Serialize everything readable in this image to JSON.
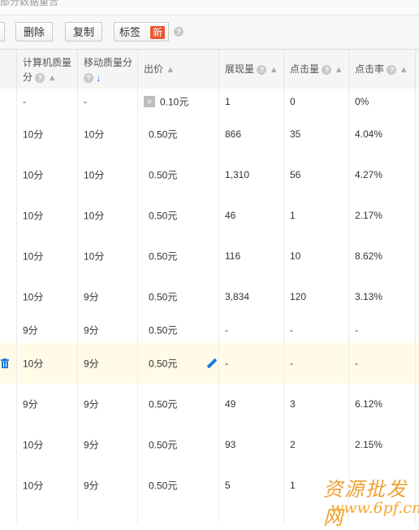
{
  "top_strip": {
    "text": "部分数据重合"
  },
  "toolbar": {
    "delete_label": "删除",
    "copy_label": "复制",
    "tag_label": "标签",
    "new_badge": "新",
    "help_glyph": "?"
  },
  "columns": {
    "pc_quality": [
      "计算机质量",
      "分"
    ],
    "mobile_quality": "移动质量分",
    "bid": "出价",
    "impressions": "展现量",
    "clicks": "点击量",
    "ctr": "点击率"
  },
  "icons": {
    "sort_asc": "sort-up-arrow-icon",
    "sort_desc_active": "sort-down-arrow-icon",
    "bid_tag": "bid-strategy-icon",
    "edit": "pencil-icon",
    "delete_row": "trash-icon"
  },
  "accent_color": "#1d7ad9",
  "badge_color": "#e9542f",
  "rows": [
    {
      "pc": "-",
      "mobile": "-",
      "bid": "0.10元",
      "impr": "1",
      "clicks": "0",
      "ctr": "0%",
      "has_bid_icon": true
    },
    {
      "pc": "10分",
      "mobile": "10分",
      "bid": "0.50元",
      "impr": "866",
      "clicks": "35",
      "ctr": "4.04%"
    },
    {
      "pc": "10分",
      "mobile": "10分",
      "bid": "0.50元",
      "impr": "1,310",
      "clicks": "56",
      "ctr": "4.27%"
    },
    {
      "pc": "10分",
      "mobile": "10分",
      "bid": "0.50元",
      "impr": "46",
      "clicks": "1",
      "ctr": "2.17%"
    },
    {
      "pc": "10分",
      "mobile": "10分",
      "bid": "0.50元",
      "impr": "116",
      "clicks": "10",
      "ctr": "8.62%"
    },
    {
      "pc": "10分",
      "mobile": "9分",
      "bid": "0.50元",
      "impr": "3,834",
      "clicks": "120",
      "ctr": "3.13%"
    },
    {
      "pc": "9分",
      "mobile": "9分",
      "bid": "0.50元",
      "impr": "-",
      "clicks": "-",
      "ctr": "-"
    },
    {
      "pc": "10分",
      "mobile": "9分",
      "bid": "0.50元",
      "impr": "-",
      "clicks": "-",
      "ctr": "-",
      "highlighted": true
    },
    {
      "pc": "9分",
      "mobile": "9分",
      "bid": "0.50元",
      "impr": "49",
      "clicks": "3",
      "ctr": "6.12%"
    },
    {
      "pc": "10分",
      "mobile": "9分",
      "bid": "0.50元",
      "impr": "93",
      "clicks": "2",
      "ctr": "2.15%"
    },
    {
      "pc": "10分",
      "mobile": "9分",
      "bid": "0.50元",
      "impr": "5",
      "clicks": "1",
      "ctr": ""
    }
  ],
  "watermark": {
    "text": "资源批发网",
    "url": "www.6pf.cn"
  }
}
